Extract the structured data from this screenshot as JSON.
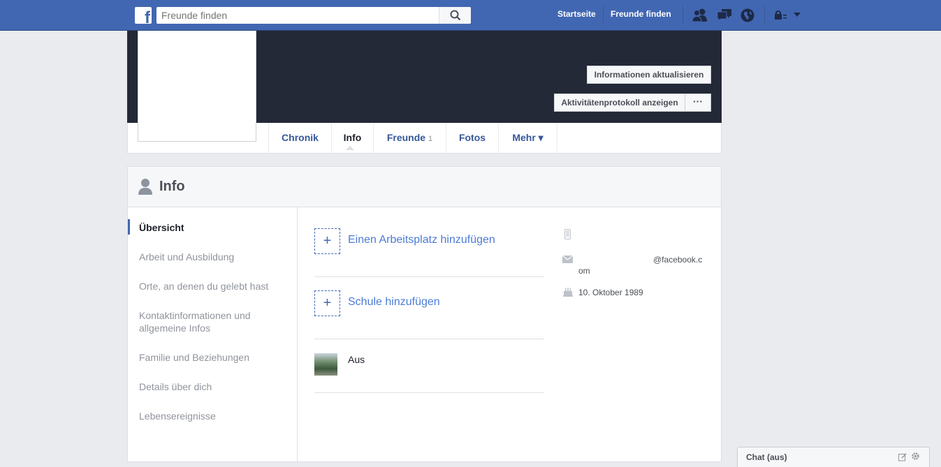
{
  "topbar": {
    "logo_letter": "f",
    "search_placeholder": "Freunde finden",
    "nav": [
      "Startseite",
      "Freunde finden"
    ],
    "icons": [
      "friend-requests-icon",
      "messages-icon",
      "notifications-globe-icon",
      "privacy-lock-icon",
      "account-caret-icon"
    ],
    "brand_color": "#4267b2"
  },
  "cover": {
    "update_info_button": "Informationen aktualisieren",
    "activity_log_button": "Aktivitätenprotokoll anzeigen",
    "more_button": "···"
  },
  "tabs": {
    "items": [
      {
        "label": "Chronik"
      },
      {
        "label": "Info"
      },
      {
        "label": "Freunde",
        "count": "1"
      },
      {
        "label": "Fotos"
      },
      {
        "label": "Mehr ▾"
      }
    ],
    "active": "Info"
  },
  "info_panel": {
    "title": "Info",
    "nav": [
      "Übersicht",
      "Arbeit und Ausbildung",
      "Orte, an denen du gelebt hast",
      "Kontaktinformationen und allgemeine Infos",
      "Familie und Beziehungen",
      "Details über dich",
      "Lebensereignisse"
    ],
    "active_nav": "Übersicht",
    "add_workplace": "Einen Arbeitsplatz hinzufügen",
    "add_school": "Schule hinzufügen",
    "hometown_prefix": "Aus",
    "email_suffix_line1": "@facebook.c",
    "email_suffix_line2": "om",
    "birthday": "10. Oktober 1989"
  },
  "chat": {
    "label": "Chat (aus)"
  }
}
